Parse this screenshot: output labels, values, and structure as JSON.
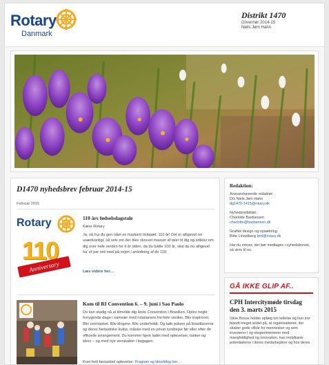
{
  "header": {
    "logo_word": "Rotary",
    "logo_sub": "Danmark",
    "district_title": "Distrikt 1470",
    "district_role": "Governør 2014-15",
    "district_name": "Niels Jørn Hahn"
  },
  "newsletter": {
    "title": "D1470 nyhedsbrev februar 2014-15",
    "date": "Februar 2015"
  },
  "articles": [
    {
      "title": "110 års fødselsdagstale",
      "greeting": "Kære Rotary",
      "body": "Ja, så hur du gen nået en markant milepæl: 110 år! Det er alligevel ret usædvanligt, så selv om der blev skrevet masser af taler til dig og artikler om dig over hele verden for ti år siden, da du fyldte 100 år, skal du nu alligevel ha' et par ord med på vejen i anledning af de 110.",
      "more": "Læs videre her...",
      "badge_number": "110",
      "badge_ribbon": "Anniversary"
    },
    {
      "title": "Kom til RI Convention 6. – 9. juni i Sao Paolo",
      "body": "Du kan stadig nå at tilmelde dig årets Convention i Brasilien. Oplev nogle forrygende dage i samvær med rotarianere fra hele verden. Bliv inspireret. Bliv overrasket. Bliv klogere. Bliv underholdt. Og køb pulsen på brasilianerne og deres fantastiske kultur, måske med en privat rundrejse før eller efter de officielle arrangement. Du kommer hjem ladet med oplevelser, tanker og ideer – og med nye venskaber i bagagen.",
      "more_prefix": "Kom helt fantastisk oplevelse.",
      "more_link": "Program og tilmelding her..."
    }
  ],
  "editorial": {
    "heading": "Redaktion:",
    "lines": [
      {
        "text": "Ansvarshavende redaktør:",
        "link": false
      },
      {
        "text": "DG Niels Jørn Hahn",
        "link": false
      },
      {
        "text": "dg1470-1415@rotary.dk",
        "link": true
      },
      {
        "text": "Nyhedsredaktør:",
        "link": false
      },
      {
        "text": "Charlotte Bastiansen",
        "link": false
      },
      {
        "text": "charlotte@bastiansen.dk",
        "link": true
      },
      {
        "text": "Grafisk design og opsætning:",
        "link": false
      },
      {
        "text": "Birte Linnetberg",
        "link": false
      },
      {
        "text": "bml@rotary.dk",
        "link": true
      },
      {
        "text": "Har du emner, der bør medtages i nyhedsbrevet, så skriv til os.",
        "link": false
      }
    ]
  },
  "alert": {
    "label": "GÅ IKKE GLIP AF..",
    "title": "CPH Intercitymøde tirsdag den 3. marts 2015",
    "body": "Stine Bosse holder oplæg om ledelse og hun tror blandt meget andet på, at organisationer, der skaber gode vilkår for mennesker og som investerer i og eksperimenterer med mangfoldighed og innovation, kan mobilisere potentialerne i deres medarbejdere og hos deres"
  },
  "colors": {
    "rotary_blue": "#17458f",
    "rotary_gold": "#f7a81b",
    "alert_red": "#d0121b",
    "link_blue": "#2b5fa8"
  },
  "icons": [
    "rotary-wheel-icon"
  ]
}
